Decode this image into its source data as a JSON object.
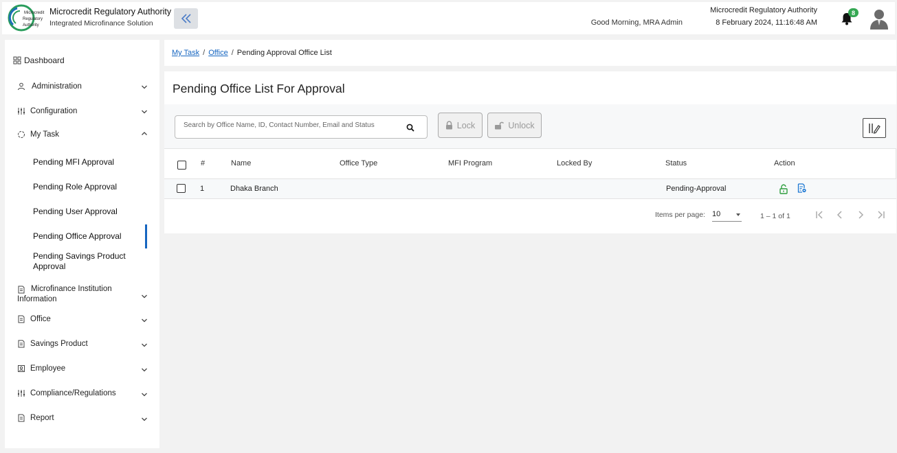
{
  "header": {
    "brand_title": "Microcredit Regulatory Authority",
    "brand_subtitle": "Integrated Microfinance Solution",
    "logo_text": [
      "Microcredit",
      "Regulatory",
      "Authority"
    ],
    "greeting": "Good Morning, MRA Admin",
    "org_name": "Microcredit Regulatory Authority",
    "datetime": "8 February 2024, 11:16:48 AM",
    "notification_count": "8"
  },
  "sidebar": {
    "dashboard": "Dashboard",
    "items": [
      {
        "label": "Administration",
        "icon": "people-icon"
      },
      {
        "label": "Configuration",
        "icon": "sliders-icon"
      },
      {
        "label": "My Task",
        "icon": "task-icon",
        "expanded": true
      },
      {
        "label": "Microfinance Institution Information",
        "icon": "document-icon"
      },
      {
        "label": "Office",
        "icon": "document-icon"
      },
      {
        "label": "Savings Product",
        "icon": "document-icon"
      },
      {
        "label": "Employee",
        "icon": "employee-icon"
      },
      {
        "label": "Compliance/Regulations",
        "icon": "sliders-icon"
      },
      {
        "label": "Report",
        "icon": "document-icon"
      }
    ],
    "my_task_sub": [
      "Pending MFI Approval",
      "Pending Role Approval",
      "Pending User Approval",
      "Pending Office Approval",
      "Pending Savings Product Approval"
    ],
    "active_sub": "Pending Office Approval",
    "accent_color": "#1565c0"
  },
  "breadcrumb": {
    "items": [
      "My Task",
      "Office"
    ],
    "current": "Pending Approval Office List"
  },
  "main": {
    "title": "Pending Office List For Approval",
    "search_placeholder": "Search by Office Name, ID, Contact Number, Email and Status",
    "lock_label": "Lock",
    "unlock_label": "Unlock",
    "columns": [
      "#",
      "Name",
      "Office Type",
      "MFI Program",
      "Locked By",
      "Status",
      "Action"
    ],
    "rows": [
      {
        "num": "1",
        "name": "Dhaka Branch",
        "office_type": "",
        "mfi_program": "",
        "locked_by": "",
        "status": "Pending-Approval"
      }
    ],
    "pagination": {
      "items_per_page_label": "Items per page:",
      "items_per_page": "10",
      "range": "1 – 1 of 1"
    },
    "action_color": "#2e9e3e",
    "view_color": "#1976d2"
  }
}
